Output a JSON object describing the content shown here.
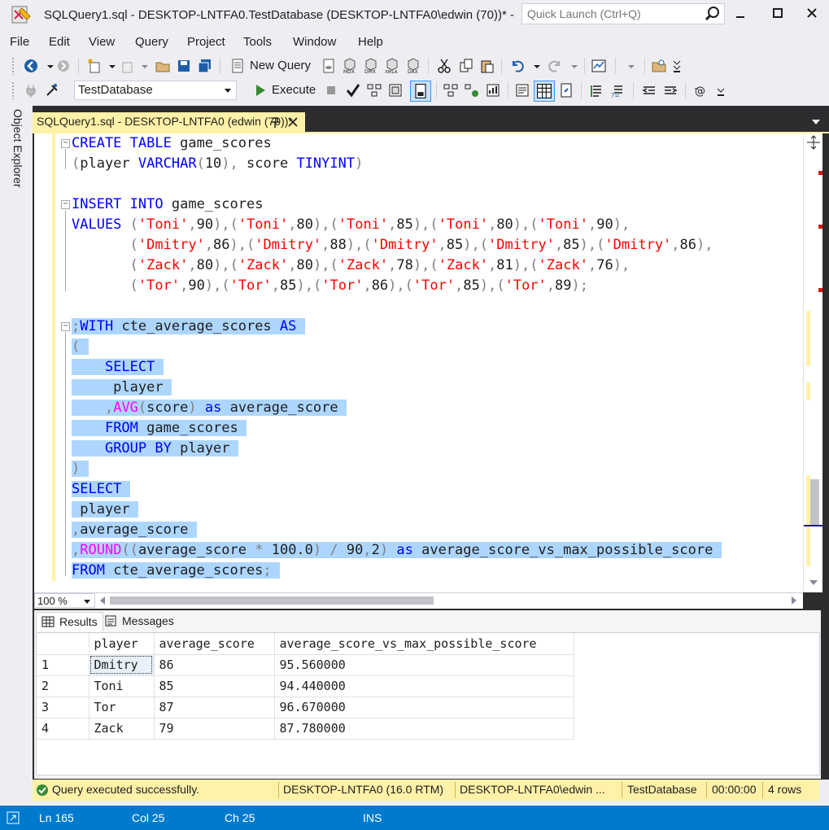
{
  "window": {
    "title": "SQLQuery1.sql - DESKTOP-LNTFA0.TestDatabase (DESKTOP-LNTFA0\\edwin (70))* - ...",
    "quick_launch_placeholder": "Quick Launch (Ctrl+Q)"
  },
  "menu": [
    "File",
    "Edit",
    "View",
    "Query",
    "Project",
    "Tools",
    "Window",
    "Help"
  ],
  "toolbar1": {
    "new_query_label": "New Query"
  },
  "toolbar2": {
    "database": "TestDatabase",
    "execute_label": "Execute"
  },
  "side_panel": {
    "object_explorer_label": "Object Explorer"
  },
  "doc_tab": {
    "label": "SQLQuery1.sql - DESKTOP-LNTFA0 (edwin (70))*"
  },
  "code": {
    "lines": [
      "CREATE TABLE game_scores",
      "(player VARCHAR(10), score TINYINT)",
      "",
      "INSERT INTO game_scores",
      "VALUES ('Toni',90),('Toni',80),('Toni',85),('Toni',80),('Toni',90),",
      "       ('Dmitry',86),('Dmitry',88),('Dmitry',85),('Dmitry',85),('Dmitry',86),",
      "       ('Zack',80),('Zack',80),('Zack',78),('Zack',81),('Zack',76),",
      "       ('Tor',90),('Tor',85),('Tor',86),('Tor',85),('Tor',89);",
      "",
      ";WITH cte_average_scores AS",
      "(",
      "    SELECT",
      "     player",
      "    ,AVG(score) as average_score",
      "    FROM game_scores",
      "    GROUP BY player",
      ")",
      "SELECT",
      " player",
      ",average_score",
      ",ROUND((average_score * 100.0) / 90,2) as average_score_vs_max_possible_score",
      "FROM cte_average_scores;"
    ]
  },
  "zoom": "100 %",
  "results_tabs": {
    "results": "Results",
    "messages": "Messages"
  },
  "grid": {
    "columns": [
      "player",
      "average_score",
      "average_score_vs_max_possible_score"
    ],
    "rows": [
      {
        "num": "1",
        "player": "Dmitry",
        "avg": "86",
        "pct": "95.560000"
      },
      {
        "num": "2",
        "player": "Toni",
        "avg": "85",
        "pct": "94.440000"
      },
      {
        "num": "3",
        "player": "Tor",
        "avg": "87",
        "pct": "96.670000"
      },
      {
        "num": "4",
        "player": "Zack",
        "avg": "79",
        "pct": "87.780000"
      }
    ]
  },
  "query_status": {
    "message": "Query executed successfully.",
    "server": "DESKTOP-LNTFA0 (16.0 RTM)",
    "user": "DESKTOP-LNTFA0\\edwin ...",
    "database": "TestDatabase",
    "elapsed": "00:00:00",
    "rows": "4 rows"
  },
  "statusbar": {
    "ln": "Ln 165",
    "col": "Col 25",
    "ch": "Ch 25",
    "mode": "INS"
  },
  "colors": {
    "accent": "#007acc",
    "doc_tab": "#fff1a8",
    "selection": "#add6ff",
    "keyword": "#0000ff",
    "string": "#ff0000",
    "function": "#ff00ff"
  }
}
